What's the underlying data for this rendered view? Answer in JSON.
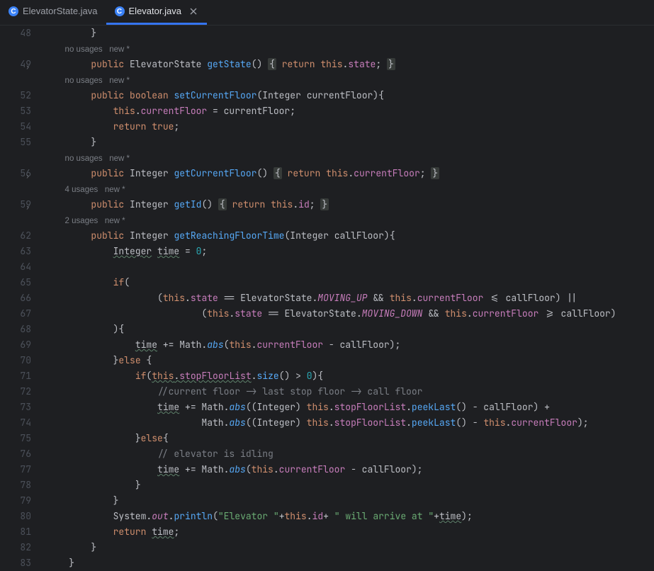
{
  "tabs": [
    {
      "label": "ElevatorState.java",
      "active": false
    },
    {
      "label": "Elevator.java",
      "active": true
    }
  ],
  "hints": {
    "no_usages_new": "no usages   new *",
    "usages4_new": "4 usages   new *",
    "usages2_new": "2 usages   new *"
  },
  "lines": [
    {
      "num": "48",
      "indent": 2,
      "tokens": [
        {
          "t": "}",
          "c": "punct"
        }
      ]
    },
    {
      "num": "",
      "indent": 2,
      "hint": "no_usages_new"
    },
    {
      "num": "49",
      "indent": 2,
      "fold": true,
      "tokens": [
        {
          "t": "public",
          "c": "kw"
        },
        {
          "t": " "
        },
        {
          "t": "ElevatorState",
          "c": "type"
        },
        {
          "t": " "
        },
        {
          "t": "getState",
          "c": "method-decl"
        },
        {
          "t": "()",
          "c": "punct"
        },
        {
          "t": " "
        },
        {
          "t": "{",
          "c": "punct hilite"
        },
        {
          "t": " "
        },
        {
          "t": "return",
          "c": "kw"
        },
        {
          "t": " "
        },
        {
          "t": "this",
          "c": "kw"
        },
        {
          "t": ".",
          "c": "punct"
        },
        {
          "t": "state",
          "c": "field"
        },
        {
          "t": "; ",
          "c": "punct"
        },
        {
          "t": "}",
          "c": "punct hilite"
        }
      ]
    },
    {
      "num": "",
      "indent": 2,
      "hint": "no_usages_new"
    },
    {
      "num": "52",
      "indent": 2,
      "tokens": [
        {
          "t": "public",
          "c": "kw"
        },
        {
          "t": " "
        },
        {
          "t": "boolean",
          "c": "kw"
        },
        {
          "t": " "
        },
        {
          "t": "setCurrentFloor",
          "c": "method-decl"
        },
        {
          "t": "(",
          "c": "punct"
        },
        {
          "t": "Integer",
          "c": "type"
        },
        {
          "t": " currentFloor)",
          "c": "punct"
        },
        {
          "t": "{",
          "c": "punct"
        }
      ]
    },
    {
      "num": "53",
      "indent": 3,
      "tokens": [
        {
          "t": "this",
          "c": "kw"
        },
        {
          "t": ".",
          "c": "punct"
        },
        {
          "t": "currentFloor",
          "c": "field"
        },
        {
          "t": " = currentFloor;",
          "c": "punct"
        }
      ]
    },
    {
      "num": "54",
      "indent": 3,
      "tokens": [
        {
          "t": "return",
          "c": "kw"
        },
        {
          "t": " "
        },
        {
          "t": "true",
          "c": "kw"
        },
        {
          "t": ";",
          "c": "punct"
        }
      ]
    },
    {
      "num": "55",
      "indent": 2,
      "tokens": [
        {
          "t": "}",
          "c": "punct"
        }
      ]
    },
    {
      "num": "",
      "indent": 2,
      "hint": "no_usages_new"
    },
    {
      "num": "56",
      "indent": 2,
      "fold": true,
      "tokens": [
        {
          "t": "public",
          "c": "kw"
        },
        {
          "t": " "
        },
        {
          "t": "Integer",
          "c": "type"
        },
        {
          "t": " "
        },
        {
          "t": "getCurrentFloor",
          "c": "method-decl"
        },
        {
          "t": "()",
          "c": "punct"
        },
        {
          "t": " "
        },
        {
          "t": "{",
          "c": "punct hilite"
        },
        {
          "t": " "
        },
        {
          "t": "return",
          "c": "kw"
        },
        {
          "t": " "
        },
        {
          "t": "this",
          "c": "kw"
        },
        {
          "t": ".",
          "c": "punct"
        },
        {
          "t": "currentFloor",
          "c": "field"
        },
        {
          "t": "; ",
          "c": "punct"
        },
        {
          "t": "}",
          "c": "punct hilite"
        }
      ]
    },
    {
      "num": "",
      "indent": 2,
      "hint": "usages4_new"
    },
    {
      "num": "59",
      "indent": 2,
      "fold": true,
      "tokens": [
        {
          "t": "public",
          "c": "kw"
        },
        {
          "t": " "
        },
        {
          "t": "Integer",
          "c": "type"
        },
        {
          "t": " "
        },
        {
          "t": "getId",
          "c": "method-decl"
        },
        {
          "t": "()",
          "c": "punct"
        },
        {
          "t": " "
        },
        {
          "t": "{",
          "c": "punct hilite"
        },
        {
          "t": " "
        },
        {
          "t": "return",
          "c": "kw"
        },
        {
          "t": " "
        },
        {
          "t": "this",
          "c": "kw"
        },
        {
          "t": ".",
          "c": "punct"
        },
        {
          "t": "id",
          "c": "field"
        },
        {
          "t": "; ",
          "c": "punct"
        },
        {
          "t": "}",
          "c": "punct hilite"
        }
      ]
    },
    {
      "num": "",
      "indent": 2,
      "hint": "usages2_new"
    },
    {
      "num": "62",
      "indent": 2,
      "tokens": [
        {
          "t": "public",
          "c": "kw"
        },
        {
          "t": " "
        },
        {
          "t": "Integer",
          "c": "type"
        },
        {
          "t": " "
        },
        {
          "t": "getReachingFloorTime",
          "c": "method-decl"
        },
        {
          "t": "(",
          "c": "punct"
        },
        {
          "t": "Integer",
          "c": "type"
        },
        {
          "t": " callFloor)",
          "c": "punct"
        },
        {
          "t": "{",
          "c": "punct"
        }
      ]
    },
    {
      "num": "63",
      "indent": 3,
      "tokens": [
        {
          "t": "Integer",
          "c": "type underline"
        },
        {
          "t": " "
        },
        {
          "t": "time",
          "c": "punct underline"
        },
        {
          "t": " = ",
          "c": "punct"
        },
        {
          "t": "0",
          "c": "num"
        },
        {
          "t": ";",
          "c": "punct"
        }
      ]
    },
    {
      "num": "64",
      "indent": 0,
      "tokens": []
    },
    {
      "num": "65",
      "indent": 3,
      "tokens": [
        {
          "t": "if",
          "c": "kw"
        },
        {
          "t": "(",
          "c": "punct"
        }
      ]
    },
    {
      "num": "66",
      "indent": 5,
      "tokens": [
        {
          "t": "(",
          "c": "punct"
        },
        {
          "t": "this",
          "c": "kw"
        },
        {
          "t": ".",
          "c": "punct"
        },
        {
          "t": "state",
          "c": "field"
        },
        {
          "t": " == ",
          "c": "punct"
        },
        {
          "t": "ElevatorState",
          "c": "type"
        },
        {
          "t": ".",
          "c": "punct"
        },
        {
          "t": "MOVING_UP",
          "c": "static-field"
        },
        {
          "t": " && ",
          "c": "punct"
        },
        {
          "t": "this",
          "c": "kw"
        },
        {
          "t": ".",
          "c": "punct"
        },
        {
          "t": "currentFloor",
          "c": "field"
        },
        {
          "t": " <= callFloor) ||",
          "c": "punct"
        }
      ]
    },
    {
      "num": "67",
      "indent": 7,
      "tokens": [
        {
          "t": "(",
          "c": "punct"
        },
        {
          "t": "this",
          "c": "kw"
        },
        {
          "t": ".",
          "c": "punct"
        },
        {
          "t": "state",
          "c": "field"
        },
        {
          "t": " == ",
          "c": "punct"
        },
        {
          "t": "ElevatorState",
          "c": "type"
        },
        {
          "t": ".",
          "c": "punct"
        },
        {
          "t": "MOVING_DOWN",
          "c": "static-field"
        },
        {
          "t": " && ",
          "c": "punct"
        },
        {
          "t": "this",
          "c": "kw"
        },
        {
          "t": ".",
          "c": "punct"
        },
        {
          "t": "currentFloor",
          "c": "field"
        },
        {
          "t": " >= callFloor)",
          "c": "punct"
        }
      ]
    },
    {
      "num": "68",
      "indent": 3,
      "tokens": [
        {
          "t": "){",
          "c": "punct"
        }
      ]
    },
    {
      "num": "69",
      "indent": 4,
      "tokens": [
        {
          "t": "time",
          "c": "punct underline"
        },
        {
          "t": " += Math.",
          "c": "punct"
        },
        {
          "t": "abs",
          "c": "method static-method"
        },
        {
          "t": "(",
          "c": "punct"
        },
        {
          "t": "this",
          "c": "kw"
        },
        {
          "t": ".",
          "c": "punct"
        },
        {
          "t": "currentFloor",
          "c": "field"
        },
        {
          "t": " - callFloor);",
          "c": "punct"
        }
      ]
    },
    {
      "num": "70",
      "indent": 3,
      "tokens": [
        {
          "t": "}",
          "c": "punct"
        },
        {
          "t": "else",
          "c": "kw"
        },
        {
          "t": " {",
          "c": "punct"
        }
      ]
    },
    {
      "num": "71",
      "indent": 4,
      "tokens": [
        {
          "t": "if",
          "c": "kw"
        },
        {
          "t": "(",
          "c": "punct"
        },
        {
          "t": "this",
          "c": "kw underline"
        },
        {
          "t": ".",
          "c": "punct underline"
        },
        {
          "t": "stopFloorList",
          "c": "field underline"
        },
        {
          "t": ".",
          "c": "punct"
        },
        {
          "t": "size",
          "c": "method"
        },
        {
          "t": "() > ",
          "c": "punct"
        },
        {
          "t": "0",
          "c": "num"
        },
        {
          "t": "){",
          "c": "punct"
        }
      ]
    },
    {
      "num": "72",
      "indent": 5,
      "tokens": [
        {
          "t": "//current floor -> last stop floor -> call floor",
          "c": "comment"
        }
      ]
    },
    {
      "num": "73",
      "indent": 5,
      "tokens": [
        {
          "t": "time",
          "c": "punct underline"
        },
        {
          "t": " += Math.",
          "c": "punct"
        },
        {
          "t": "abs",
          "c": "method static-method"
        },
        {
          "t": "((",
          "c": "punct"
        },
        {
          "t": "Integer",
          "c": "type"
        },
        {
          "t": ") ",
          "c": "punct"
        },
        {
          "t": "this",
          "c": "kw"
        },
        {
          "t": ".",
          "c": "punct"
        },
        {
          "t": "stopFloorList",
          "c": "field"
        },
        {
          "t": ".",
          "c": "punct"
        },
        {
          "t": "peekLast",
          "c": "method"
        },
        {
          "t": "() - callFloor) +",
          "c": "punct"
        }
      ]
    },
    {
      "num": "74",
      "indent": 7,
      "tokens": [
        {
          "t": "Math.",
          "c": "punct"
        },
        {
          "t": "abs",
          "c": "method static-method"
        },
        {
          "t": "((",
          "c": "punct"
        },
        {
          "t": "Integer",
          "c": "type"
        },
        {
          "t": ") ",
          "c": "punct"
        },
        {
          "t": "this",
          "c": "kw"
        },
        {
          "t": ".",
          "c": "punct"
        },
        {
          "t": "stopFloorList",
          "c": "field"
        },
        {
          "t": ".",
          "c": "punct"
        },
        {
          "t": "peekLast",
          "c": "method"
        },
        {
          "t": "() - ",
          "c": "punct"
        },
        {
          "t": "this",
          "c": "kw"
        },
        {
          "t": ".",
          "c": "punct"
        },
        {
          "t": "currentFloor",
          "c": "field"
        },
        {
          "t": ");",
          "c": "punct"
        }
      ]
    },
    {
      "num": "75",
      "indent": 4,
      "tokens": [
        {
          "t": "}",
          "c": "punct"
        },
        {
          "t": "else",
          "c": "kw"
        },
        {
          "t": "{",
          "c": "punct"
        }
      ]
    },
    {
      "num": "76",
      "indent": 5,
      "tokens": [
        {
          "t": "// elevator is idling",
          "c": "comment"
        }
      ]
    },
    {
      "num": "77",
      "indent": 5,
      "tokens": [
        {
          "t": "time",
          "c": "punct underline"
        },
        {
          "t": " += Math.",
          "c": "punct"
        },
        {
          "t": "abs",
          "c": "method static-method"
        },
        {
          "t": "(",
          "c": "punct"
        },
        {
          "t": "this",
          "c": "kw"
        },
        {
          "t": ".",
          "c": "punct"
        },
        {
          "t": "currentFloor",
          "c": "field"
        },
        {
          "t": " - callFloor);",
          "c": "punct"
        }
      ]
    },
    {
      "num": "78",
      "indent": 4,
      "tokens": [
        {
          "t": "}",
          "c": "punct"
        }
      ]
    },
    {
      "num": "79",
      "indent": 3,
      "tokens": [
        {
          "t": "}",
          "c": "punct"
        }
      ]
    },
    {
      "num": "80",
      "indent": 3,
      "tokens": [
        {
          "t": "System",
          "c": "type"
        },
        {
          "t": ".",
          "c": "punct"
        },
        {
          "t": "out",
          "c": "static-field"
        },
        {
          "t": ".",
          "c": "punct"
        },
        {
          "t": "println",
          "c": "method"
        },
        {
          "t": "(",
          "c": "punct"
        },
        {
          "t": "\"Elevator \"",
          "c": "str"
        },
        {
          "t": "+",
          "c": "punct"
        },
        {
          "t": "this",
          "c": "kw"
        },
        {
          "t": ".",
          "c": "punct"
        },
        {
          "t": "id",
          "c": "field"
        },
        {
          "t": "+ ",
          "c": "punct"
        },
        {
          "t": "\" will arrive at \"",
          "c": "str"
        },
        {
          "t": "+",
          "c": "punct"
        },
        {
          "t": "time",
          "c": "punct underline"
        },
        {
          "t": ");",
          "c": "punct"
        }
      ]
    },
    {
      "num": "81",
      "indent": 3,
      "tokens": [
        {
          "t": "return",
          "c": "kw"
        },
        {
          "t": " "
        },
        {
          "t": "time",
          "c": "punct underline"
        },
        {
          "t": ";",
          "c": "punct"
        }
      ]
    },
    {
      "num": "82",
      "indent": 2,
      "tokens": [
        {
          "t": "}",
          "c": "punct"
        }
      ]
    },
    {
      "num": "83",
      "indent": 1,
      "tokens": [
        {
          "t": "}",
          "c": "punct"
        }
      ]
    }
  ]
}
